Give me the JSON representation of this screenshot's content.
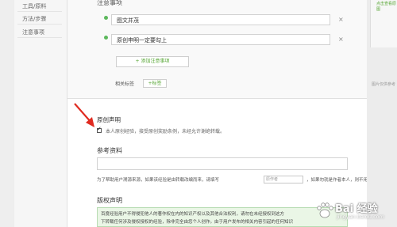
{
  "left_nav": {
    "items": [
      {
        "label": "工具/原料"
      },
      {
        "label": "方法/步骤"
      },
      {
        "label": "注意事项"
      }
    ]
  },
  "notes_section": {
    "title": "注意事项",
    "notes": [
      {
        "text": "图文并茂"
      },
      {
        "text": "原创申明一定要勾上"
      }
    ],
    "remove_symbol": "×",
    "add_note_label": "+ 添加注意事项",
    "tags_label": "相关标签",
    "add_tag_label": "+标签"
  },
  "original_statement": {
    "title": "原创声明",
    "checked": true,
    "text": "本人原创经验，接受原创奖励条例，未经允许谢绝转载。"
  },
  "reference": {
    "title": "参考资料",
    "hint": "为了帮助用户溯源来源，如果该经验是由转载改编而来，请填写",
    "author_placeholder": "原作者",
    "hint_tail": "，如果勿就是作者本人，则不用填写。"
  },
  "copyright": {
    "title": "版权声明",
    "text": "百度经验用户不得侵犯他人的著作权在内的知识产权以及其他合法权利，请勿在未经授权到这方\n下转载任何涉及侵权授权的经验，除非完全由您个人创作。由于用户发布的相关内容引起的任何知识"
  },
  "right_column": {
    "thumb_label": "点击查看原图",
    "thumb2_label": "图片仅供参考"
  },
  "watermark": {
    "brand": "Bai 经验",
    "url": "jingyan.baidu.com"
  },
  "colors": {
    "accent_green": "#55a532",
    "bullet_green": "#5cb85c",
    "arrow_red": "#e02b20",
    "copyright_bg": "#eaf6e6"
  }
}
